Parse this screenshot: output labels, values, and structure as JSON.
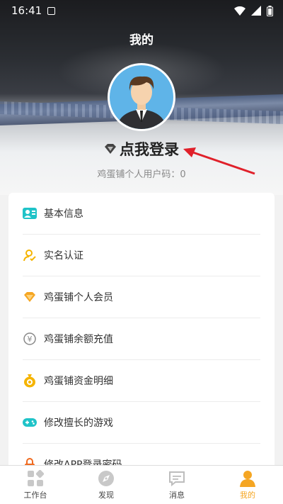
{
  "status": {
    "time": "16:41"
  },
  "header": {
    "title": "我的",
    "login_text": "点我登录",
    "uid_text": "鸡蛋铺个人用户码：0"
  },
  "menu": [
    {
      "label": "基本信息",
      "icon": "id-card-icon",
      "color": "#1fc3c8"
    },
    {
      "label": "实名认证",
      "icon": "user-verify-icon",
      "color": "#f5b400"
    },
    {
      "label": "鸡蛋铺个人会员",
      "icon": "diamond-icon",
      "color": "#f5a623"
    },
    {
      "label": "鸡蛋铺余额充值",
      "icon": "yuan-coin-icon",
      "color": "#888888"
    },
    {
      "label": "鸡蛋铺资金明细",
      "icon": "money-bag-icon",
      "color": "#f5b400"
    },
    {
      "label": "修改擅长的游戏",
      "icon": "gamepad-icon",
      "color": "#1fc3c8"
    },
    {
      "label": "修改APP登录密码",
      "icon": "lock-icon",
      "color": "#f06a1f"
    }
  ],
  "tabs": [
    {
      "label": "工作台",
      "icon": "grid-icon"
    },
    {
      "label": "发现",
      "icon": "compass-icon"
    },
    {
      "label": "消息",
      "icon": "message-icon"
    },
    {
      "label": "我的",
      "icon": "person-icon",
      "active": true
    }
  ],
  "colors": {
    "accent": "#f5a623",
    "arrow": "#e0202a"
  }
}
